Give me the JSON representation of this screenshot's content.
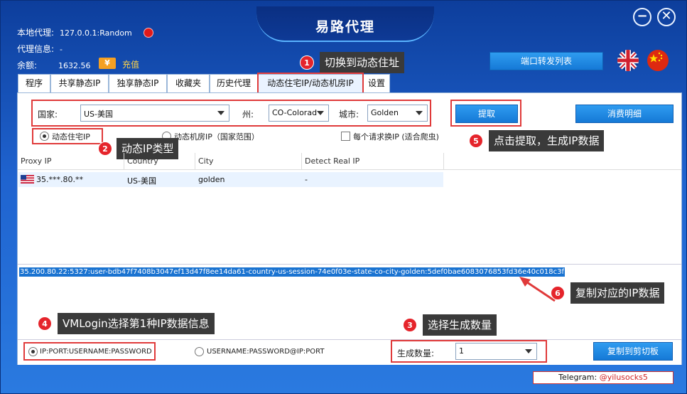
{
  "window": {
    "title": "易路代理",
    "minimize_symbol": "−",
    "close_symbol": "✕"
  },
  "info": {
    "local_proxy_label": "本地代理:",
    "local_proxy_value": "127.0.0.1:Random",
    "proxy_info_label": "代理信息:",
    "proxy_info_value": "-",
    "balance_label": "余额:",
    "balance_value": "1632.56",
    "recharge_icon": "¥",
    "recharge_label": "充值"
  },
  "buttons": {
    "port_forward": "端口转发列表",
    "extract": "提取",
    "consumption": "消费明细",
    "copy_clipboard": "复制到剪切板"
  },
  "tabs": [
    {
      "label": "程序"
    },
    {
      "label": "共享静态IP"
    },
    {
      "label": "独享静态IP"
    },
    {
      "label": "收藏夹"
    },
    {
      "label": "历史代理"
    },
    {
      "label": "动态住宅IP/动态机房IP"
    },
    {
      "label": "设置"
    }
  ],
  "filters": {
    "country_label": "国家:",
    "country_value": "US-美国",
    "state_label": "州:",
    "state_value": "CO-Colorad",
    "city_label": "城市:",
    "city_value": "Golden"
  },
  "options": {
    "dynamic_residential": "动态住宅IP",
    "dynamic_datacenter": "动态机房IP（国家范围）",
    "per_request": "每个请求换IP (适合爬虫)"
  },
  "table": {
    "headers": [
      "Proxy IP",
      "Country",
      "City",
      "Detect Real IP"
    ],
    "rows": [
      {
        "proxy_ip": "35.***.80.**",
        "country": "US-美国",
        "city": "golden",
        "detect": "-"
      }
    ]
  },
  "output_line": "35.200.80.22:5327:user-bdb47f7408b3047ef13d47f8ee14da61-country-us-session-74e0f03e-state-co-city-golden:5def0bae6083076853fd36e40c018c3f",
  "bottom": {
    "format1": "IP:PORT:USERNAME:PASSWORD",
    "format2": "USERNAME:PASSWORD@IP:PORT",
    "count_label": "生成数量:",
    "count_value": "1"
  },
  "telegram": {
    "label": "Telegram: ",
    "handle": "@yilusocks5"
  },
  "callouts": [
    {
      "num": "1",
      "text": "切换到动态住址"
    },
    {
      "num": "2",
      "text": "动态IP类型"
    },
    {
      "num": "3",
      "text": "选择生成数量"
    },
    {
      "num": "4",
      "text": "VMLogin选择第1种IP数据信息"
    },
    {
      "num": "5",
      "text": "点击提取，生成IP数据"
    },
    {
      "num": "6",
      "text": "复制对应的IP数据"
    }
  ],
  "colors": {
    "highlight": "#e03a3a",
    "accent_blue": "#1a73d1",
    "brand_dark": "#0d3e9c"
  }
}
